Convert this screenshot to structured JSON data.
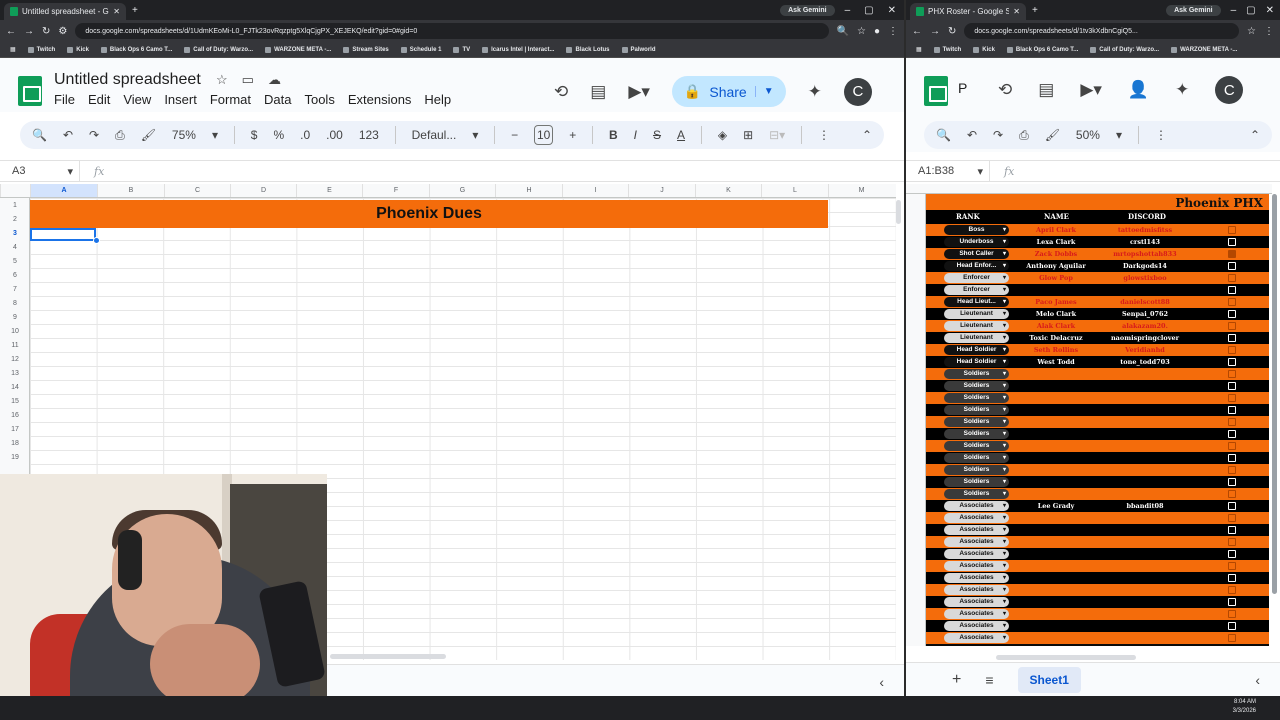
{
  "left": {
    "tab_title": "Untitled spreadsheet - Google",
    "ask_gemini": "Ask Gemini",
    "url": "docs.google.com/spreadsheets/d/1UdmKEoMi-L0_FJTk23ovRqzptg5XlqCjgPX_XEJEKQ/edit?gid=0#gid=0",
    "bookmarks": [
      "Twitch",
      "Kick",
      "Black Ops 6 Camo T...",
      "Call of Duty: Warzo...",
      "WARZONE META -...",
      "Stream Sites",
      "Schedule 1",
      "TV",
      "Icarus Intel | Interact...",
      "Black Lotus",
      "Palworld"
    ],
    "doc_title": "Untitled spreadsheet",
    "menus": [
      "File",
      "Edit",
      "View",
      "Insert",
      "Format",
      "Data",
      "Tools",
      "Extensions",
      "Help"
    ],
    "share_label": "Share",
    "avatar_letter": "C",
    "toolbar": {
      "zoom": "75%",
      "currency": "$",
      "percent": "%",
      "dec_less": ".0",
      "dec_more": ".00",
      "number_format": "123",
      "font": "Defaul...",
      "font_size": "10",
      "bold": "B",
      "italic": "I",
      "strike": "S",
      "text_color": "A"
    },
    "name_box": "A3",
    "fx": "fx",
    "columns": [
      "A",
      "B",
      "C",
      "D",
      "E",
      "F",
      "G",
      "H",
      "I",
      "J",
      "K",
      "L",
      "M"
    ],
    "rows": [
      "1",
      "2",
      "3",
      "4",
      "5",
      "6",
      "7",
      "8",
      "9",
      "10",
      "11",
      "12",
      "13",
      "14",
      "15",
      "16",
      "17",
      "18",
      "19"
    ],
    "banner": "Phoenix Dues"
  },
  "right": {
    "tab_title": "PHX Roster - Google Sheets",
    "ask_gemini": "Ask Gemini",
    "url": "docs.google.com/spreadsheets/d/1tv3kXdbnCgiQ5...",
    "bookmarks": [
      "Twitch",
      "Kick",
      "Black Ops 6 Camo T...",
      "Call of Duty: Warzo...",
      "WARZONE META -..."
    ],
    "title_initial": "P",
    "avatar_letter": "C",
    "zoom": "50%",
    "name_box": "A1:B38",
    "fx": "fx",
    "sheet_tab": "Sheet1",
    "roster": {
      "title": "Phoenix PHX",
      "headers": {
        "rank": "RANK",
        "name": "NAME",
        "discord": "DISCORD"
      },
      "rows": [
        {
          "rank": "Boss",
          "name": "April Clark",
          "discord": "tattoedmisfitss",
          "style": "orange",
          "checked": false
        },
        {
          "rank": "Underboss",
          "name": "Lexa Clark",
          "discord": "crstl143",
          "style": "black",
          "checked": false
        },
        {
          "rank": "Shot Caller",
          "name": "Zack Dobbs",
          "discord": "mrtopshottah833",
          "style": "orange",
          "checked": true
        },
        {
          "rank": "Head Enfor...",
          "name": "Anthony Aguilar",
          "discord": "Darkgods14",
          "style": "black",
          "checked": false
        },
        {
          "rank": "Enforcer",
          "name": "Glow Pop",
          "discord": "glowstixboo",
          "style": "orange",
          "checked": false
        },
        {
          "rank": "Enforcer",
          "name": "",
          "discord": "",
          "style": "black",
          "checked": false
        },
        {
          "rank": "Head Lieut...",
          "name": "Paco James",
          "discord": "danielscott88",
          "style": "orange",
          "checked": false
        },
        {
          "rank": "Lieutenant",
          "name": "Melo Clark",
          "discord": "Senpai_0762",
          "style": "black",
          "checked": false
        },
        {
          "rank": "Lieutenant",
          "name": "Alak Clark",
          "discord": "alakazam20.",
          "style": "orange",
          "checked": false
        },
        {
          "rank": "Lieutenant",
          "name": "Toxic Delacruz",
          "discord": "naomispringclover",
          "style": "black",
          "checked": false
        },
        {
          "rank": "Head Soldier",
          "name": "Seth Rollins",
          "discord": "Veridianhd",
          "style": "orange",
          "checked": false
        },
        {
          "rank": "Head Soldier",
          "name": "West Todd",
          "discord": "tone_todd703",
          "style": "black",
          "checked": false
        },
        {
          "rank": "Soldiers",
          "name": "",
          "discord": "",
          "style": "orange",
          "checked": false
        },
        {
          "rank": "Soldiers",
          "name": "",
          "discord": "",
          "style": "black",
          "checked": false
        },
        {
          "rank": "Soldiers",
          "name": "",
          "discord": "",
          "style": "orange",
          "checked": false
        },
        {
          "rank": "Soldiers",
          "name": "",
          "discord": "",
          "style": "black",
          "checked": false
        },
        {
          "rank": "Soldiers",
          "name": "",
          "discord": "",
          "style": "orange",
          "checked": false
        },
        {
          "rank": "Soldiers",
          "name": "",
          "discord": "",
          "style": "black",
          "checked": false
        },
        {
          "rank": "Soldiers",
          "name": "",
          "discord": "",
          "style": "orange",
          "checked": false
        },
        {
          "rank": "Soldiers",
          "name": "",
          "discord": "",
          "style": "black",
          "checked": false
        },
        {
          "rank": "Soldiers",
          "name": "",
          "discord": "",
          "style": "orange",
          "checked": false
        },
        {
          "rank": "Soldiers",
          "name": "",
          "discord": "",
          "style": "black",
          "checked": false
        },
        {
          "rank": "Soldiers",
          "name": "",
          "discord": "",
          "style": "orange",
          "checked": false
        },
        {
          "rank": "Associates",
          "name": "Lee Grady",
          "discord": "bbandit08",
          "style": "black",
          "checked": false
        },
        {
          "rank": "Associates",
          "name": "",
          "discord": "",
          "style": "orange",
          "checked": false
        },
        {
          "rank": "Associates",
          "name": "",
          "discord": "",
          "style": "black",
          "checked": false
        },
        {
          "rank": "Associates",
          "name": "",
          "discord": "",
          "style": "orange",
          "checked": false
        },
        {
          "rank": "Associates",
          "name": "",
          "discord": "",
          "style": "black",
          "checked": false
        },
        {
          "rank": "Associates",
          "name": "",
          "discord": "",
          "style": "orange",
          "checked": false
        },
        {
          "rank": "Associates",
          "name": "",
          "discord": "",
          "style": "black",
          "checked": false
        },
        {
          "rank": "Associates",
          "name": "",
          "discord": "",
          "style": "orange",
          "checked": false
        },
        {
          "rank": "Associates",
          "name": "",
          "discord": "",
          "style": "black",
          "checked": false
        },
        {
          "rank": "Associates",
          "name": "",
          "discord": "",
          "style": "orange",
          "checked": false
        },
        {
          "rank": "Associates",
          "name": "",
          "discord": "",
          "style": "black",
          "checked": false
        },
        {
          "rank": "Associates",
          "name": "",
          "discord": "",
          "style": "orange",
          "checked": false
        }
      ]
    }
  },
  "taskbar": {
    "time": "8:04 AM",
    "date": "3/3/2026"
  },
  "colors": {
    "orange": "#f46c0b",
    "share_bg": "#c2e7ff",
    "selection": "#1a73e8",
    "sheets_green": "#0f9d58"
  }
}
